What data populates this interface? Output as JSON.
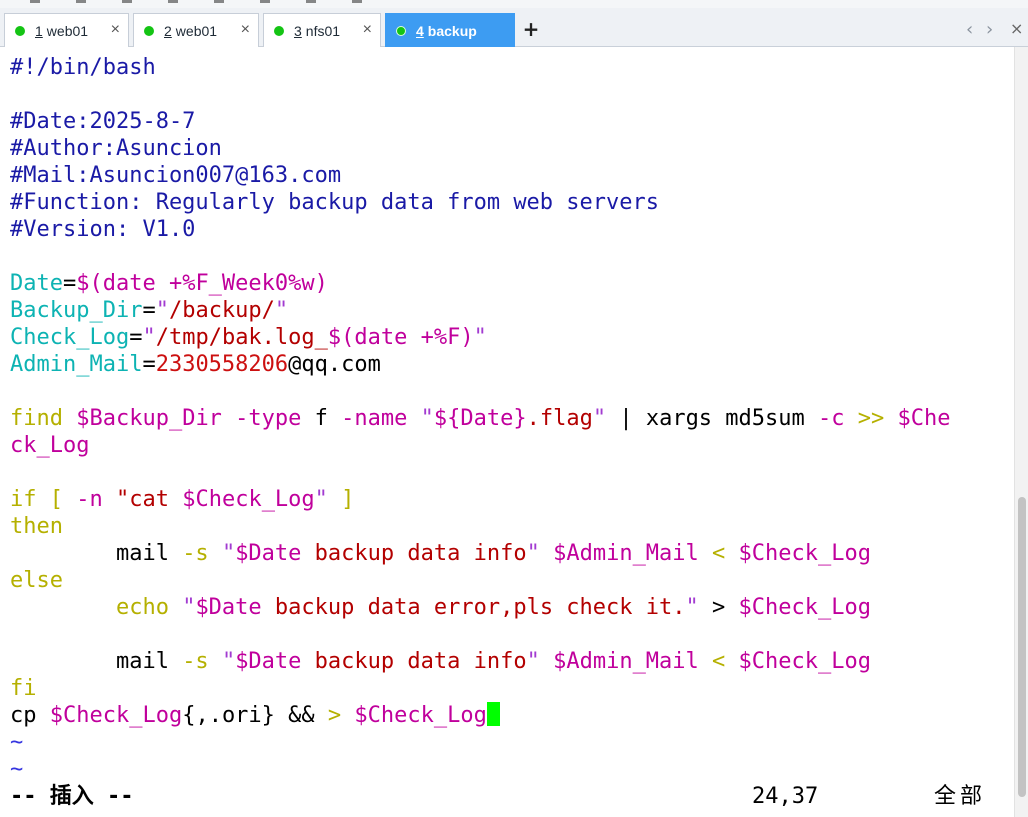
{
  "tabs": [
    {
      "num": "1",
      "label": "web01",
      "active": false
    },
    {
      "num": "2",
      "label": "web01",
      "active": false
    },
    {
      "num": "3",
      "label": "nfs01",
      "active": false
    },
    {
      "num": "4",
      "label": "backup",
      "active": true
    }
  ],
  "tab_controls": {
    "add": "+",
    "prev": "‹",
    "next": "›",
    "close": "×"
  },
  "terminal": {
    "lines": [
      [
        {
          "t": "#!/bin/bash",
          "c": "comment"
        }
      ],
      [],
      [
        {
          "t": "#Date:2025-8-7",
          "c": "comment"
        }
      ],
      [
        {
          "t": "#Author:Asuncion",
          "c": "comment"
        }
      ],
      [
        {
          "t": "#Mail:Asuncion007@163.com",
          "c": "comment"
        }
      ],
      [
        {
          "t": "#Function: Regularly backup data from web servers",
          "c": "comment"
        }
      ],
      [
        {
          "t": "#Version: V1.0",
          "c": "comment"
        }
      ],
      [],
      [
        {
          "t": "Date",
          "c": "var"
        },
        {
          "t": "=",
          "c": ""
        },
        {
          "t": "$(date +%F_Week0%w)",
          "c": "sub"
        }
      ],
      [
        {
          "t": "Backup_Dir",
          "c": "var"
        },
        {
          "t": "=",
          "c": ""
        },
        {
          "t": "\"",
          "c": "str"
        },
        {
          "t": "/backup/",
          "c": "red"
        },
        {
          "t": "\"",
          "c": "str"
        }
      ],
      [
        {
          "t": "Check_Log",
          "c": "var"
        },
        {
          "t": "=",
          "c": ""
        },
        {
          "t": "\"",
          "c": "str"
        },
        {
          "t": "/tmp/bak.log_",
          "c": "red"
        },
        {
          "t": "$(date +%F)",
          "c": "sub"
        },
        {
          "t": "\"",
          "c": "str"
        }
      ],
      [
        {
          "t": "Admin_Mail",
          "c": "var"
        },
        {
          "t": "=",
          "c": ""
        },
        {
          "t": "2330558206",
          "c": "num"
        },
        {
          "t": "@qq.com",
          "c": ""
        }
      ],
      [],
      [
        {
          "t": "find ",
          "c": "kw"
        },
        {
          "t": "$Backup_Dir",
          "c": "sub"
        },
        {
          "t": " -type ",
          "c": "sub"
        },
        {
          "t": "f ",
          "c": ""
        },
        {
          "t": "-name ",
          "c": "sub"
        },
        {
          "t": "\"",
          "c": "str"
        },
        {
          "t": "${Date}",
          "c": "sub"
        },
        {
          "t": ".flag",
          "c": "red"
        },
        {
          "t": "\"",
          "c": "str"
        },
        {
          "t": " | xargs md5sum ",
          "c": ""
        },
        {
          "t": "-c ",
          "c": "sub"
        },
        {
          "t": ">> ",
          "c": "kw"
        },
        {
          "t": "$Che",
          "c": "sub"
        }
      ],
      [
        {
          "t": "ck_Log",
          "c": "sub"
        }
      ],
      [],
      [
        {
          "t": "if [ ",
          "c": "kw"
        },
        {
          "t": "-n ",
          "c": "sub"
        },
        {
          "t": "\"",
          "c": "red"
        },
        {
          "t": "cat ",
          "c": "red"
        },
        {
          "t": "$Check_Log",
          "c": "sub"
        },
        {
          "t": "\"",
          "c": "str"
        },
        {
          "t": " ]",
          "c": "kw"
        }
      ],
      [
        {
          "t": "then",
          "c": "kw"
        }
      ],
      [
        {
          "t": "        mail ",
          "c": ""
        },
        {
          "t": "-s ",
          "c": "kw"
        },
        {
          "t": "\"",
          "c": "str"
        },
        {
          "t": "$Date",
          "c": "sub"
        },
        {
          "t": " backup data info",
          "c": "red"
        },
        {
          "t": "\" ",
          "c": "str"
        },
        {
          "t": "$Admin_Mail",
          "c": "sub"
        },
        {
          "t": " < ",
          "c": "kw"
        },
        {
          "t": "$Check_Log",
          "c": "sub"
        }
      ],
      [
        {
          "t": "else",
          "c": "kw"
        }
      ],
      [
        {
          "t": "        echo ",
          "c": "kw"
        },
        {
          "t": "\"",
          "c": "str"
        },
        {
          "t": "$Date",
          "c": "sub"
        },
        {
          "t": " backup data error,pls check it.",
          "c": "red"
        },
        {
          "t": "\" ",
          "c": "str"
        },
        {
          "t": "> ",
          "c": ""
        },
        {
          "t": "$Check_Log",
          "c": "sub"
        }
      ],
      [],
      [
        {
          "t": "        mail ",
          "c": ""
        },
        {
          "t": "-s ",
          "c": "kw"
        },
        {
          "t": "\"",
          "c": "str"
        },
        {
          "t": "$Date",
          "c": "sub"
        },
        {
          "t": " backup data info",
          "c": "red"
        },
        {
          "t": "\" ",
          "c": "str"
        },
        {
          "t": "$Admin_Mail",
          "c": "sub"
        },
        {
          "t": " < ",
          "c": "kw"
        },
        {
          "t": "$Check_Log",
          "c": "sub"
        }
      ],
      [
        {
          "t": "fi",
          "c": "kw"
        }
      ],
      [
        {
          "t": "cp ",
          "c": ""
        },
        {
          "t": "$Check_Log",
          "c": "sub"
        },
        {
          "t": "{,.ori} && ",
          "c": ""
        },
        {
          "t": "> ",
          "c": "kw"
        },
        {
          "t": "$Check_Log",
          "c": "sub"
        },
        {
          "t": "",
          "c": "cursor"
        }
      ],
      [
        {
          "t": "~",
          "c": "tilde"
        }
      ],
      [
        {
          "t": "~",
          "c": "tilde"
        }
      ]
    ],
    "status_mode": "-- 插入 --",
    "cursor_position": "24,37",
    "scope": "全部"
  },
  "colors": {
    "active_tab": "#3d9cf2",
    "status_dot": "#14c414",
    "cursor": "#00ff00"
  }
}
